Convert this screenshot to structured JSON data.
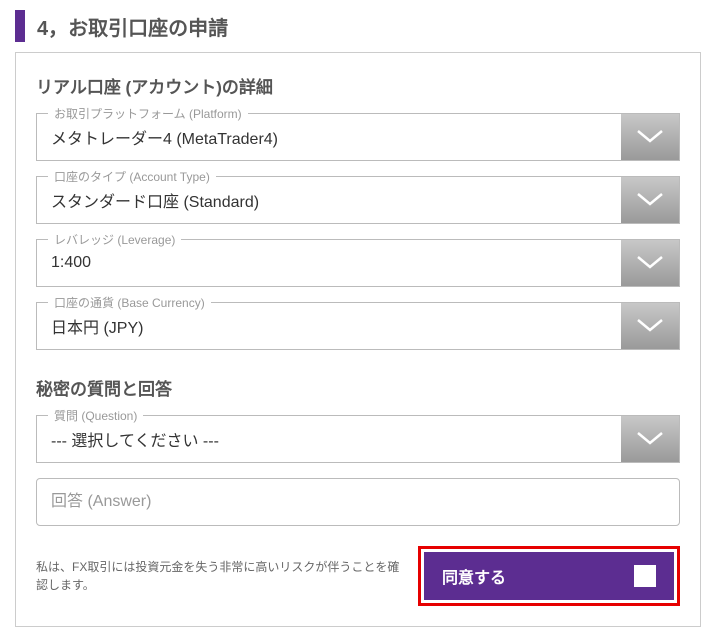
{
  "section_title": "4，お取引口座の申請",
  "subsection1_title": "リアル口座 (アカウント)の詳細",
  "platform": {
    "label": "お取引プラットフォーム (Platform)",
    "value": "メタトレーダー4 (MetaTrader4)"
  },
  "account_type": {
    "label": "口座のタイプ (Account Type)",
    "value": "スタンダード口座 (Standard)"
  },
  "leverage": {
    "label": "レバレッジ (Leverage)",
    "value": "1:400"
  },
  "base_currency": {
    "label": "口座の通貨 (Base Currency)",
    "value": "日本円 (JPY)"
  },
  "subsection2_title": "秘密の質問と回答",
  "question": {
    "label": "質問 (Question)",
    "value": "--- 選択してください ---"
  },
  "answer": {
    "placeholder": "回答 (Answer)"
  },
  "risk_text": "私は、FX取引には投資元金を失う非常に高いリスクが伴うことを確認します。",
  "agree_label": "同意する"
}
